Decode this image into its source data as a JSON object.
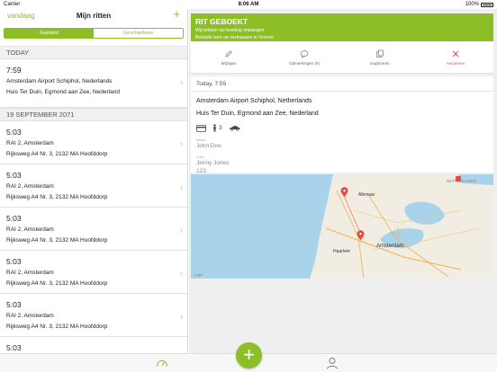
{
  "status": {
    "carrier": "Carrier",
    "time": "8:06 AM",
    "battery": "100%"
  },
  "left": {
    "back_label": "vandaag",
    "title": "Mijn ritten",
    "add_label": "+",
    "segments": [
      "Gepland",
      "Geschiedenis"
    ],
    "sections": [
      {
        "label": "TODAY"
      },
      {
        "label": "19 SEPTEMBER 2071"
      }
    ],
    "today_ride": {
      "time": "7:59",
      "from": "Amsterdam Airport Schiphol, Nederlands",
      "to": "Huis Ter Duin, Egmond aan Zee, Nederland"
    },
    "rides": [
      {
        "time": "5:03",
        "from": "RAI 2, Amsterdam",
        "to": "Rijksweg A4 Nr. 3, 2132 MA Hoofddorp"
      },
      {
        "time": "5:03",
        "from": "RAI 2, Amsterdam",
        "to": "Rijksweg A4 Nr. 3, 2132 MA Hoofddorp"
      },
      {
        "time": "5:03",
        "from": "RAI 2, Amsterdam",
        "to": "Rijksweg A4 Nr. 3, 2132 MA Hoofddorp"
      },
      {
        "time": "5:03",
        "from": "RAI 2, Amsterdam",
        "to": "Rijksweg A4 Nr. 3, 2132 MA Hoofddorp"
      },
      {
        "time": "5:03",
        "from": "RAI 2, Amsterdam",
        "to": "Rijksweg A4 Nr. 3, 2132 MA Hoofddorp"
      },
      {
        "time": "5:03",
        "from": "",
        "to": ""
      }
    ]
  },
  "banner": {
    "title": "RIT GEBOEKT",
    "line1": "Wij hebben uw boeking ontvangen",
    "line2": "Bedankt voor uw vertrouwen in Vervoer"
  },
  "actions": [
    {
      "label": "Wijzigen",
      "icon": "pencil-icon"
    },
    {
      "label": "Opmerkingen (0)",
      "icon": "comment-icon"
    },
    {
      "label": "Dupliceren",
      "icon": "duplicate-icon"
    },
    {
      "label": "Annuleren",
      "icon": "close-icon"
    }
  ],
  "detail": {
    "time": "Today, 7:59",
    "from": "Amsterdam Airport Schiphol, Netherlands",
    "to": "Huis Ter Duin, Egmond aan Zee, Nederland",
    "passengers": "3",
    "fields": [
      {
        "label": "Naam",
        "value": "John Doe"
      },
      {
        "label": "Gast",
        "value": "Jenny Jones"
      },
      {
        "label": "",
        "value": "123"
      }
    ]
  },
  "map": {
    "labels": [
      "Alkmaar",
      "Amsterdam",
      "Haarlem",
      "NETHERLANDS",
      "Legal"
    ],
    "colors": {
      "water": "#a9d3ea",
      "land": "#f1ede2",
      "accent": "#e84a3c"
    }
  },
  "colors": {
    "accent": "#8cbf26",
    "danger": "#e84848"
  }
}
